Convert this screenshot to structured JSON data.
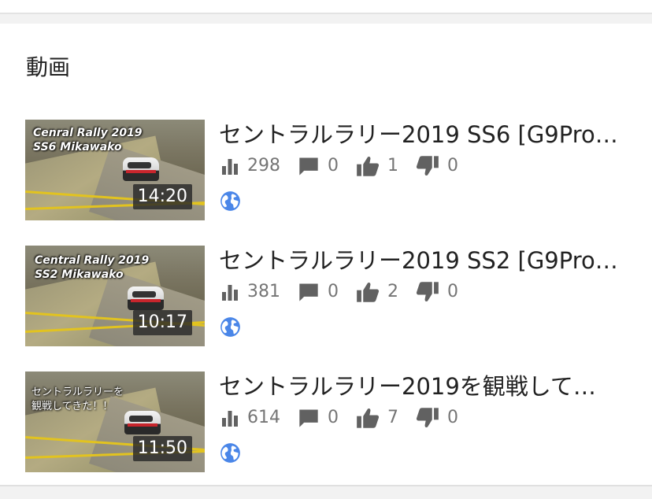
{
  "section": {
    "title": "動画"
  },
  "colors": {
    "icon_gray": "#616161",
    "globe_blue": "#4a86e8",
    "text": "#222222",
    "meta": "#757575"
  },
  "videos": [
    {
      "title": "セントラルラリー2019 SS6 [G9Pro…",
      "thumb_text": "Cenral Rally 2019\nSS6 Mikawako",
      "duration": "14:20",
      "views": "298",
      "comments": "0",
      "likes": "1",
      "dislikes": "0",
      "privacy_icon": "globe-icon"
    },
    {
      "title": "セントラルラリー2019 SS2 [G9Pro…",
      "thumb_text": "Central Rally 2019\nSS2 Mikawako",
      "duration": "10:17",
      "views": "381",
      "comments": "0",
      "likes": "2",
      "dislikes": "0",
      "privacy_icon": "globe-icon"
    },
    {
      "title": "セントラルラリー2019を観戦して…",
      "thumb_text": "セントラルラリーを\n観戦してきた！！",
      "duration": "11:50",
      "views": "614",
      "comments": "0",
      "likes": "7",
      "dislikes": "0",
      "privacy_icon": "globe-icon"
    }
  ]
}
